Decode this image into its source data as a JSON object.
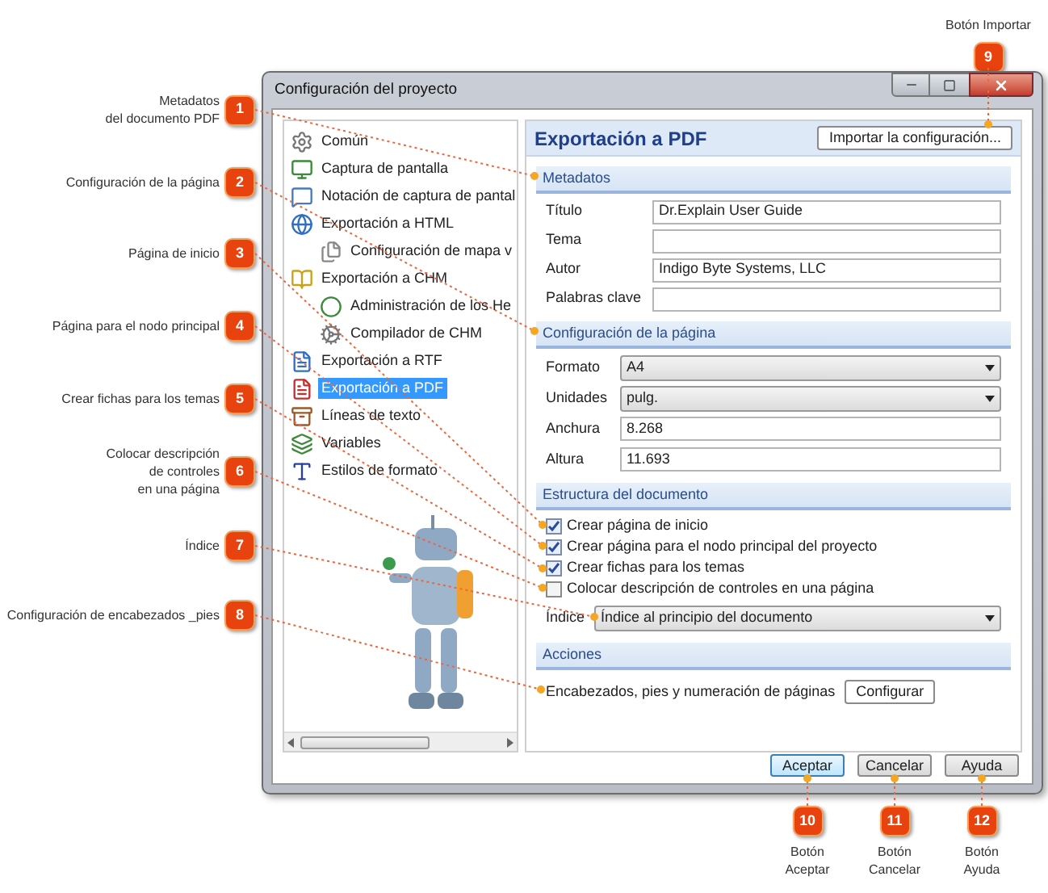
{
  "left_callouts": [
    {
      "number": "1",
      "lines": [
        "Metadatos",
        "del documento PDF"
      ]
    },
    {
      "number": "2",
      "lines": [
        "Configuración de la página"
      ]
    },
    {
      "number": "3",
      "lines": [
        "Página de inicio"
      ]
    },
    {
      "number": "4",
      "lines": [
        "Página para el nodo principal"
      ]
    },
    {
      "number": "5",
      "lines": [
        "Crear fichas para los temas"
      ]
    },
    {
      "number": "6",
      "lines": [
        "Colocar descripción",
        "de controles",
        "en una página"
      ]
    },
    {
      "number": "7",
      "lines": [
        "Índice"
      ]
    },
    {
      "number": "8",
      "lines": [
        "Configuración de encabezados _pies"
      ]
    }
  ],
  "top_callouts": [
    {
      "number": "9",
      "lines": [
        "Botón Importar"
      ]
    }
  ],
  "bottom_callouts": [
    {
      "number": "10",
      "lines": [
        "Botón",
        "Aceptar"
      ]
    },
    {
      "number": "11",
      "lines": [
        "Botón",
        "Cancelar"
      ]
    },
    {
      "number": "12",
      "lines": [
        "Botón",
        "Ayuda"
      ]
    }
  ],
  "window": {
    "title": "Configuración del proyecto"
  },
  "tree": [
    {
      "label": "Común",
      "selected": false
    },
    {
      "label": "Captura de pantalla",
      "selected": false
    },
    {
      "label": "Notación de captura de pantal",
      "selected": false
    },
    {
      "label": "Exportación a HTML",
      "selected": false,
      "children": [
        {
          "label": "Configuración de mapa v",
          "selected": false
        }
      ]
    },
    {
      "label": "Exportación a CHM",
      "selected": false,
      "children": [
        {
          "label": "Administración de los He",
          "selected": false
        },
        {
          "label": "Compilador de CHM",
          "selected": false
        }
      ]
    },
    {
      "label": "Exportación a RTF",
      "selected": false
    },
    {
      "label": "Exportación a PDF",
      "selected": true
    },
    {
      "label": "Líneas de texto",
      "selected": false
    },
    {
      "label": "Variables",
      "selected": false
    },
    {
      "label": "Estilos de formato",
      "selected": false
    }
  ],
  "panel": {
    "title": "Exportación a PDF",
    "import_button": "Importar la configuración...",
    "metadata": {
      "heading": "Metadatos",
      "fields": [
        {
          "label": "Título",
          "value": "Dr.Explain User Guide"
        },
        {
          "label": "Tema"
        },
        {
          "label": "Autor",
          "value": "Indigo Byte Systems, LLC"
        },
        {
          "label": "Palabras clave"
        }
      ]
    },
    "page_setup": {
      "heading": "Configuración de la página",
      "rows": [
        {
          "kind": "select",
          "label": "Formato",
          "value": "A4"
        },
        {
          "kind": "select",
          "label": "Unidades",
          "value": "pulg."
        },
        {
          "kind": "text",
          "label": "Anchura",
          "value": "8.268"
        },
        {
          "kind": "text",
          "label": "Altura",
          "value": "11.693"
        }
      ]
    },
    "structure": {
      "heading": "Estructura del documento",
      "checkboxes": [
        {
          "label": "Crear página de inicio",
          "checked": true
        },
        {
          "label": "Crear página para el nodo principal del proyecto",
          "checked": true
        },
        {
          "label": "Crear fichas para los temas",
          "checked": true
        },
        {
          "label": "Colocar descripción de controles en una página",
          "checked": false
        }
      ],
      "index": {
        "label": "Índice",
        "value": "Índice al principio del documento"
      }
    },
    "actions": {
      "heading": "Acciones",
      "label": "Encabezados, pies y numeración de páginas",
      "button": "Configurar"
    }
  },
  "buttons": [
    {
      "label": "Aceptar",
      "default": true
    },
    {
      "label": "Cancelar",
      "default": false
    },
    {
      "label": "Ayuda",
      "default": false
    }
  ]
}
